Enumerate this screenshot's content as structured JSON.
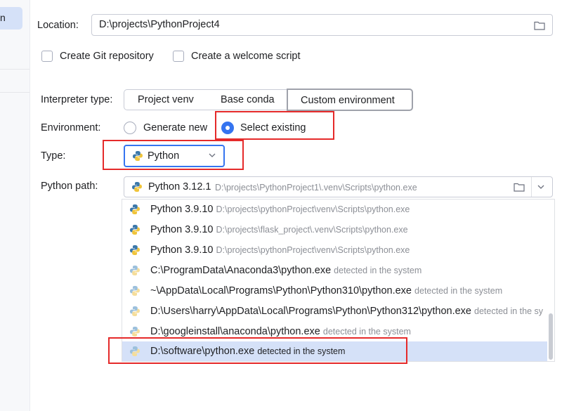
{
  "sidebar": {
    "selected_label": "n"
  },
  "form": {
    "location_label": "Location:",
    "location_value": "D:\\projects\\PythonProject4",
    "git_label": "Create Git repository",
    "welcome_label": "Create a welcome script",
    "interpreter_type_label": "Interpreter type:",
    "interpreter_tabs": [
      "Project venv",
      "Base conda",
      "Custom environment"
    ],
    "environment_label": "Environment:",
    "env_options": [
      "Generate new",
      "Select existing"
    ],
    "type_label": "Type:",
    "type_value": "Python",
    "python_path_label": "Python path:",
    "python_path_version": "Python 3.12.1",
    "python_path_value": "D:\\projects\\PythonProject1\\.venv\\Scripts\\python.exe"
  },
  "dropdown": {
    "items": [
      {
        "name": "Python 3.9.10",
        "path": "D:\\projects\\pythonProject\\venv\\Scripts\\python.exe"
      },
      {
        "name": "Python 3.9.10",
        "path": "D:\\projects\\flask_project\\.venv\\Scripts\\python.exe"
      },
      {
        "name": "Python 3.9.10",
        "path": "D:\\projects\\pythonProject\\venv\\Scripts\\python.exe"
      },
      {
        "name": "C:\\ProgramData\\Anaconda3\\python.exe",
        "path": "detected in the system"
      },
      {
        "name": "~\\AppData\\Local\\Programs\\Python\\Python310\\python.exe",
        "path": "detected in the system"
      },
      {
        "name": "D:\\Users\\harry\\AppData\\Local\\Programs\\Python\\Python312\\python.exe",
        "path": "detected in the sy"
      },
      {
        "name": "D:\\googleinstall\\anaconda\\python.exe",
        "path": "detected in the system"
      },
      {
        "name": "D:\\software\\python.exe",
        "path": "detected in the system"
      }
    ]
  },
  "colors": {
    "accent": "#3574f0",
    "highlight_box": "#e52a2a",
    "selected_row": "#d5e1f8"
  },
  "icons": {
    "python": "python-logo-icon",
    "folder": "folder-icon",
    "chevron": "chevron-down-icon"
  }
}
